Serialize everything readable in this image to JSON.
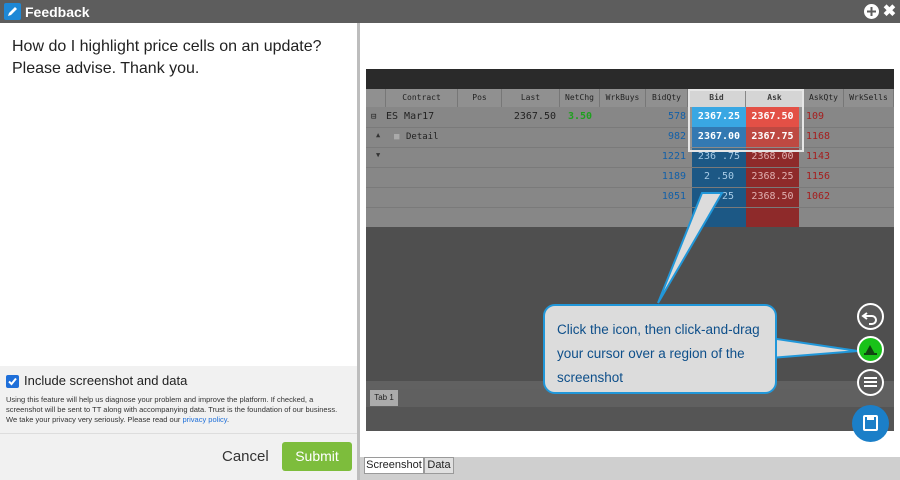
{
  "window": {
    "title": "Feedback",
    "close_glyph": "✖",
    "icons": {
      "app": "pencil-icon",
      "add": "plus-circle-icon",
      "close": "close-icon"
    }
  },
  "left": {
    "message_lines": [
      "How do I highlight price cells on an update?",
      "Please advise. Thank you."
    ],
    "include_label": "Include screenshot and data",
    "include_checked": true,
    "disclaimer_text": "Using this feature will help us diagnose your problem and improve the platform. If checked, a screenshot will be sent to TT along with accompanying data. Trust is the foundation of our business. We take your privacy very seriously. Please read our ",
    "privacy_link": "privacy policy",
    "privacy_suffix": ".",
    "cancel_label": "Cancel",
    "submit_label": "Submit"
  },
  "screenshot": {
    "headers": [
      "Contract",
      "Pos",
      "Last",
      "NetChg",
      "WrkBuys",
      "BidQty",
      "Bid",
      "Ask",
      "AskQty",
      "WrkSells"
    ],
    "contract": "ES Mar17",
    "detail_label": "Detail",
    "last": "2367.50",
    "netchg": "3.50",
    "bidqty": [
      "578",
      "982",
      "1221",
      "1189",
      "1051"
    ],
    "bids": [
      "2367.25",
      "2367.00",
      "2366.75",
      "2366.50",
      "2366.25"
    ],
    "bids_visible": [
      "2367.25",
      "2367.00",
      "236 .75",
      "2 .50",
      "66.25"
    ],
    "asks": [
      "2367.50",
      "2367.75",
      "2368.00",
      "2368.25",
      "2368.50"
    ],
    "askqty": [
      "109",
      "1168",
      "1143",
      "1156",
      "1062"
    ],
    "tab_label": "Tab 1"
  },
  "callout": {
    "text": "Click the icon, then click-and-drag your cursor over a region of the screenshot"
  },
  "tools": [
    "undo-icon",
    "select-region-icon",
    "data-view-icon",
    "save-icon"
  ],
  "tabs": [
    "Screenshot",
    "Data"
  ],
  "colors": {
    "titlebar": "#5d5d5d",
    "accent_blue": "#2197d9",
    "submit_green": "#7dbd3c",
    "bid_highlight": "#1e9be0",
    "ask_highlight": "#e0382d",
    "select_tool_green": "#19c219"
  }
}
